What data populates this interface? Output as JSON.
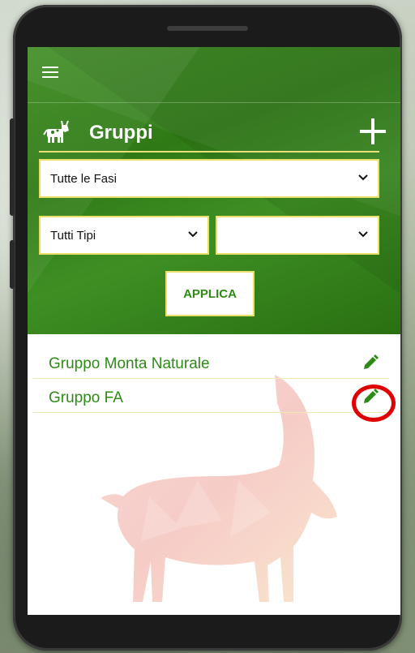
{
  "app": {
    "title": "Gruppi",
    "accent_color": "#2e8a17",
    "border_color": "#e9df6a"
  },
  "filters": {
    "phase_select": {
      "value": "Tutte le Fasi"
    },
    "type_select": {
      "value": "Tutti Tipi"
    },
    "secondary_select": {
      "value": ""
    },
    "apply_label": "APPLICA"
  },
  "groups": [
    {
      "name": "Gruppo Monta Naturale",
      "icon": "pencil-icon"
    },
    {
      "name": "Gruppo FA",
      "icon": "pencil-icon",
      "highlighted": true
    }
  ],
  "icons": {
    "menu": "hamburger-menu-icon",
    "section": "cow-icon",
    "add": "plus-icon",
    "dropdown": "chevron-down-icon"
  }
}
